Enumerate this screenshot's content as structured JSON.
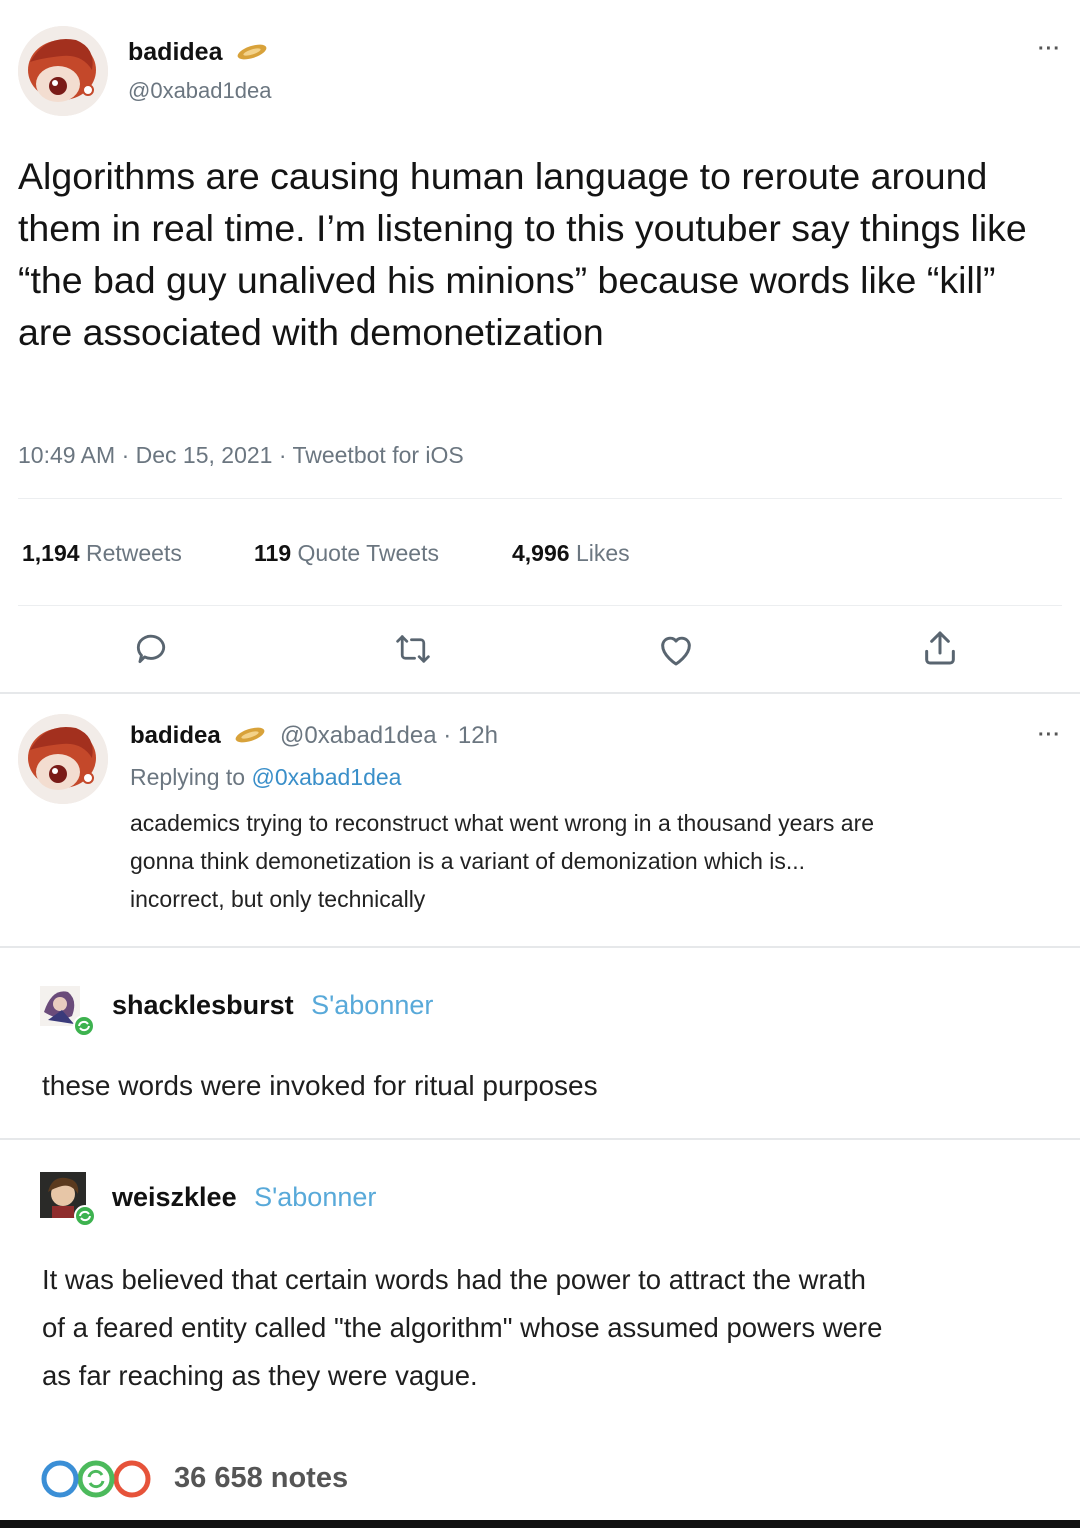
{
  "tweet": {
    "display_name": "badidea",
    "handle": "@0xabad1dea",
    "text": "Algorithms are causing human language to reroute around them in real time. I’m listening to this youtuber say things like “the bad guy unalived his minions” because words like “kill” are associated with demonetization",
    "meta": "10:49 AM · Dec 15, 2021 · Tweetbot for iOS",
    "more": "···",
    "stats": {
      "retweets_num": "1,194",
      "retweets_label": "Retweets",
      "quotes_num": "119",
      "quotes_label": "Quote Tweets",
      "likes_num": "4,996",
      "likes_label": "Likes"
    },
    "actions": [
      "reply-icon",
      "retweet-icon",
      "like-icon",
      "share-icon"
    ]
  },
  "reply": {
    "display_name": "badidea",
    "handle_time": "@0xabad1dea · 12h",
    "replying_prefix": "Replying to",
    "replying_handle": "@0xabad1dea",
    "text_lines": [
      "academics trying to reconstruct what went wrong in a thousand years are",
      "gonna think demonetization is a variant of demonization which is...",
      "incorrect, but only technically"
    ],
    "more": "···"
  },
  "tumblr_posts": [
    {
      "username": "shacklesburst",
      "follow": "S'abonner",
      "text": "these words were invoked for ritual purposes"
    },
    {
      "username": "weiszklee",
      "follow": "S'abonner",
      "text_lines": [
        "It was believed that certain words had the power to attract the wrath",
        "of a feared entity called \"the algorithm\" whose assumed powers were",
        "as far reaching as they were vague."
      ]
    }
  ],
  "notes": {
    "count": "36 658 notes"
  },
  "colors": {
    "accent": "#3a8fc9",
    "follow": "#58a9d9",
    "verified_gold": "#d8a23a",
    "notes_blue": "#3b8fd6",
    "notes_green": "#4cba5c",
    "notes_orange": "#e6533a"
  }
}
